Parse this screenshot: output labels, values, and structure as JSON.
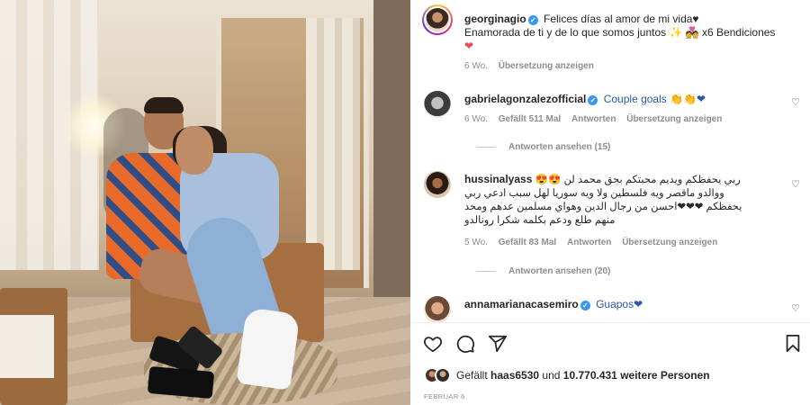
{
  "post": {
    "author": "georginagio",
    "caption_line1": "Felices días al amor de mi vida♥",
    "caption_line2": "Enamorada de ti y de lo que somos juntos",
    "caption_emojis": "✨ 💑",
    "caption_bless": "x6 Bendiciones",
    "caption_heart": "❤",
    "age": "6 Wo.",
    "translate": "Übersetzung anzeigen"
  },
  "comments": [
    {
      "user": "gabrielagonzalezofficial",
      "verified": true,
      "text": "Couple goals 👏👏❤",
      "age": "6 Wo.",
      "likes": "Gefällt 511 Mal",
      "reply": "Antworten",
      "translate": "Übersetzung anzeigen",
      "view_replies": "Antworten ansehen (15)"
    },
    {
      "user": "hussinalyass",
      "verified": false,
      "text_line1": "ربي يحفظكم ويديم محبتكم بحق محمد لن 😍😍",
      "text_line2": "ووالدو ماقصر ويه فلسطين ولا ويه سوريا لهل سبب ادعي ربي",
      "text_line3": "يحفظكم ❤❤❤احسن من رجال الدين وهواي مسلمين عدهم ومحد",
      "text_line4": "منهم طلع ودعم بكلمه شكرا رونالدو",
      "age": "5 Wo.",
      "likes": "Gefällt 83 Mal",
      "reply": "Antworten",
      "translate": "Übersetzung anzeigen",
      "view_replies": "Antworten ansehen (20)"
    },
    {
      "user": "annamarianacasemiro",
      "verified": true,
      "text": "Guapos❤"
    }
  ],
  "actions": {
    "like_icon": "heart-outline-icon",
    "comment_icon": "comment-icon",
    "share_icon": "paper-plane-icon",
    "save_icon": "bookmark-icon"
  },
  "likes": {
    "prefix": "Gefällt",
    "user": "haas6530",
    "middle": "und",
    "count": "10.770.431 weitere Personen"
  },
  "date": "FEBRUAR 6",
  "colors": {
    "accent_blue": "#3897f0",
    "meta_gray": "#8e8e8e",
    "text": "#262626"
  }
}
